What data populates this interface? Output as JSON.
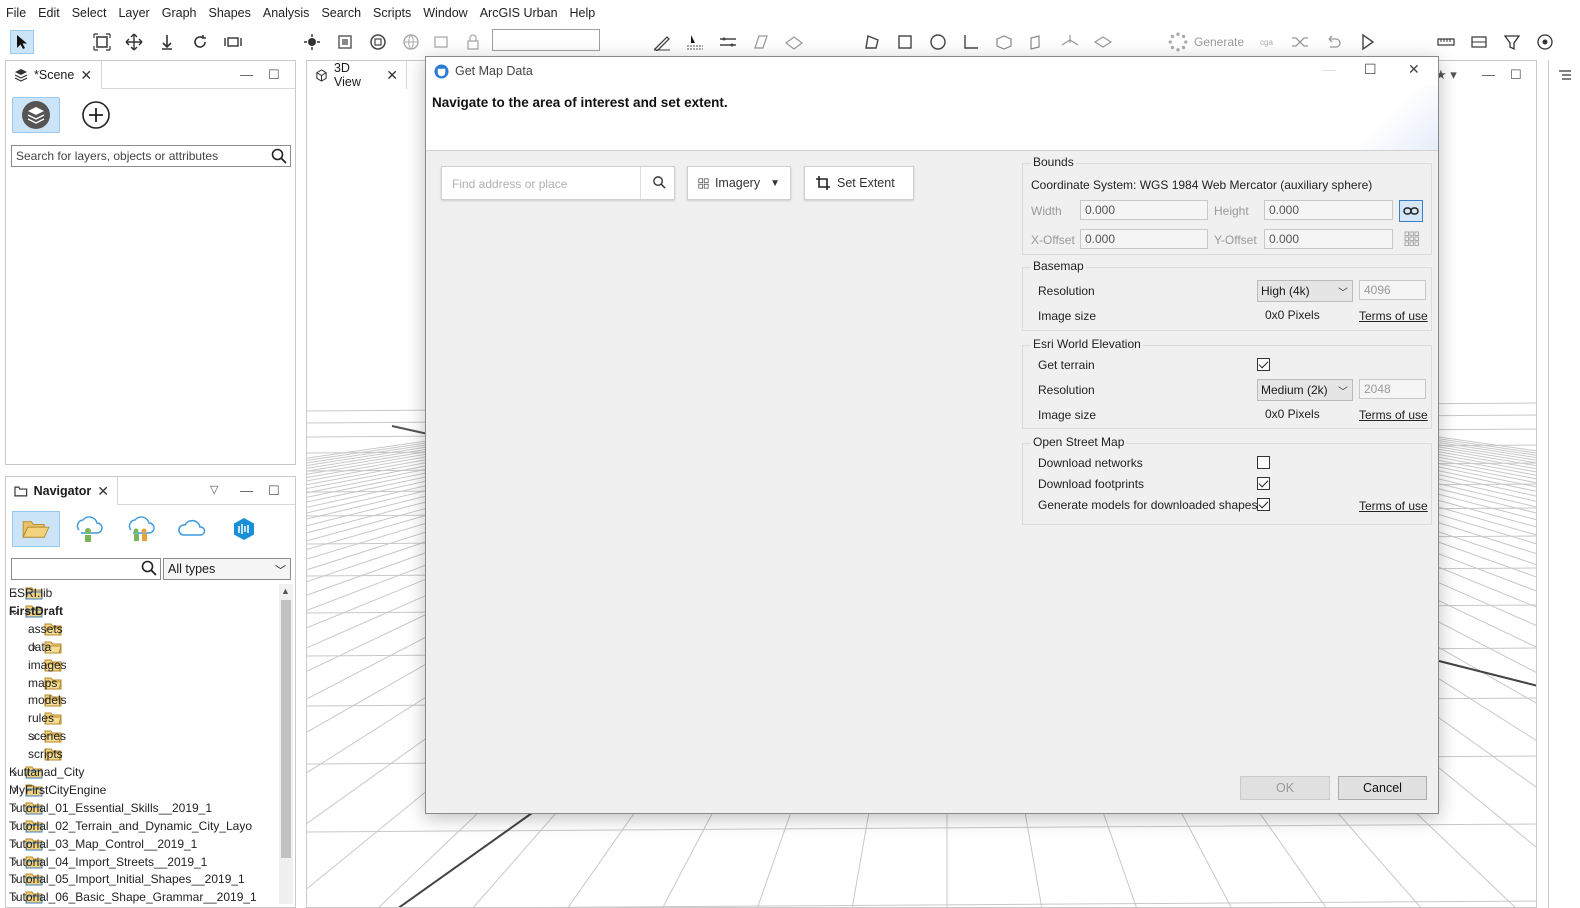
{
  "menu": [
    "File",
    "Edit",
    "Select",
    "Layer",
    "Graph",
    "Shapes",
    "Analysis",
    "Search",
    "Scripts",
    "Window",
    "ArcGIS Urban",
    "Help"
  ],
  "toolbar": {
    "generate_label": "Generate"
  },
  "scene_panel": {
    "tab_label": "*Scene",
    "search_placeholder": "Search for layers, objects or attributes"
  },
  "viewport": {
    "tab_label": "3D View"
  },
  "navigator": {
    "tab_label": "Navigator",
    "type_filter": "All types",
    "tree": [
      {
        "label": "ESRI.lib",
        "depth": 0,
        "expand": "collapsed",
        "bold": false
      },
      {
        "label": "FirstDraft",
        "depth": 0,
        "expand": "expanded",
        "bold": true
      },
      {
        "label": "assets",
        "depth": 1,
        "expand": "none",
        "bold": false
      },
      {
        "label": "data",
        "depth": 1,
        "expand": "collapsed",
        "bold": false
      },
      {
        "label": "images",
        "depth": 1,
        "expand": "none",
        "bold": false
      },
      {
        "label": "maps",
        "depth": 1,
        "expand": "none",
        "bold": false
      },
      {
        "label": "models",
        "depth": 1,
        "expand": "none",
        "bold": false
      },
      {
        "label": "rules",
        "depth": 1,
        "expand": "none",
        "bold": false
      },
      {
        "label": "scenes",
        "depth": 1,
        "expand": "collapsed",
        "bold": false
      },
      {
        "label": "scripts",
        "depth": 1,
        "expand": "none",
        "bold": false
      },
      {
        "label": "Kuttanad_City",
        "depth": 0,
        "expand": "collapsed",
        "bold": false
      },
      {
        "label": "MyFirstCityEngine",
        "depth": 0,
        "expand": "collapsed",
        "bold": false
      },
      {
        "label": "Tutorial_01_Essential_Skills__2019_1",
        "depth": 0,
        "expand": "collapsed",
        "bold": false
      },
      {
        "label": "Tutorial_02_Terrain_and_Dynamic_City_Layo",
        "depth": 0,
        "expand": "collapsed",
        "bold": false
      },
      {
        "label": "Tutorial_03_Map_Control__2019_1",
        "depth": 0,
        "expand": "collapsed",
        "bold": false
      },
      {
        "label": "Tutorial_04_Import_Streets__2019_1",
        "depth": 0,
        "expand": "collapsed",
        "bold": false
      },
      {
        "label": "Tutorial_05_Import_Initial_Shapes__2019_1",
        "depth": 0,
        "expand": "collapsed",
        "bold": false
      },
      {
        "label": "Tutorial_06_Basic_Shape_Grammar__2019_1",
        "depth": 0,
        "expand": "collapsed",
        "bold": false
      }
    ]
  },
  "dialog": {
    "title": "Get Map Data",
    "instruction": "Navigate to the area of interest and set extent.",
    "search_placeholder": "Find address or place",
    "imagery_label": "Imagery",
    "set_extent_label": "Set Extent",
    "bounds": {
      "title": "Bounds",
      "coord_system": "Coordinate System: WGS 1984 Web Mercator (auxiliary sphere)",
      "width_label": "Width",
      "width_value": "0.000",
      "height_label": "Height",
      "height_value": "0.000",
      "xoffset_label": "X-Offset",
      "xoffset_value": "0.000",
      "yoffset_label": "Y-Offset",
      "yoffset_value": "0.000"
    },
    "basemap": {
      "title": "Basemap",
      "resolution_label": "Resolution",
      "resolution_value": "High (4k)",
      "resolution_px": "4096",
      "image_size_label": "Image size",
      "image_size_value": "0x0 Pixels",
      "terms": "Terms of use"
    },
    "elevation": {
      "title": "Esri World Elevation",
      "get_terrain_label": "Get terrain",
      "get_terrain": true,
      "resolution_label": "Resolution",
      "resolution_value": "Medium (2k)",
      "resolution_px": "2048",
      "image_size_label": "Image size",
      "image_size_value": "0x0 Pixels",
      "terms": "Terms of use"
    },
    "osm": {
      "title": "Open Street Map",
      "networks_label": "Download networks",
      "networks": false,
      "footprints_label": "Download footprints",
      "footprints": true,
      "generate_label": "Generate models for downloaded shapes",
      "generate": true,
      "terms": "Terms of use"
    },
    "ok_label": "OK",
    "cancel_label": "Cancel"
  }
}
